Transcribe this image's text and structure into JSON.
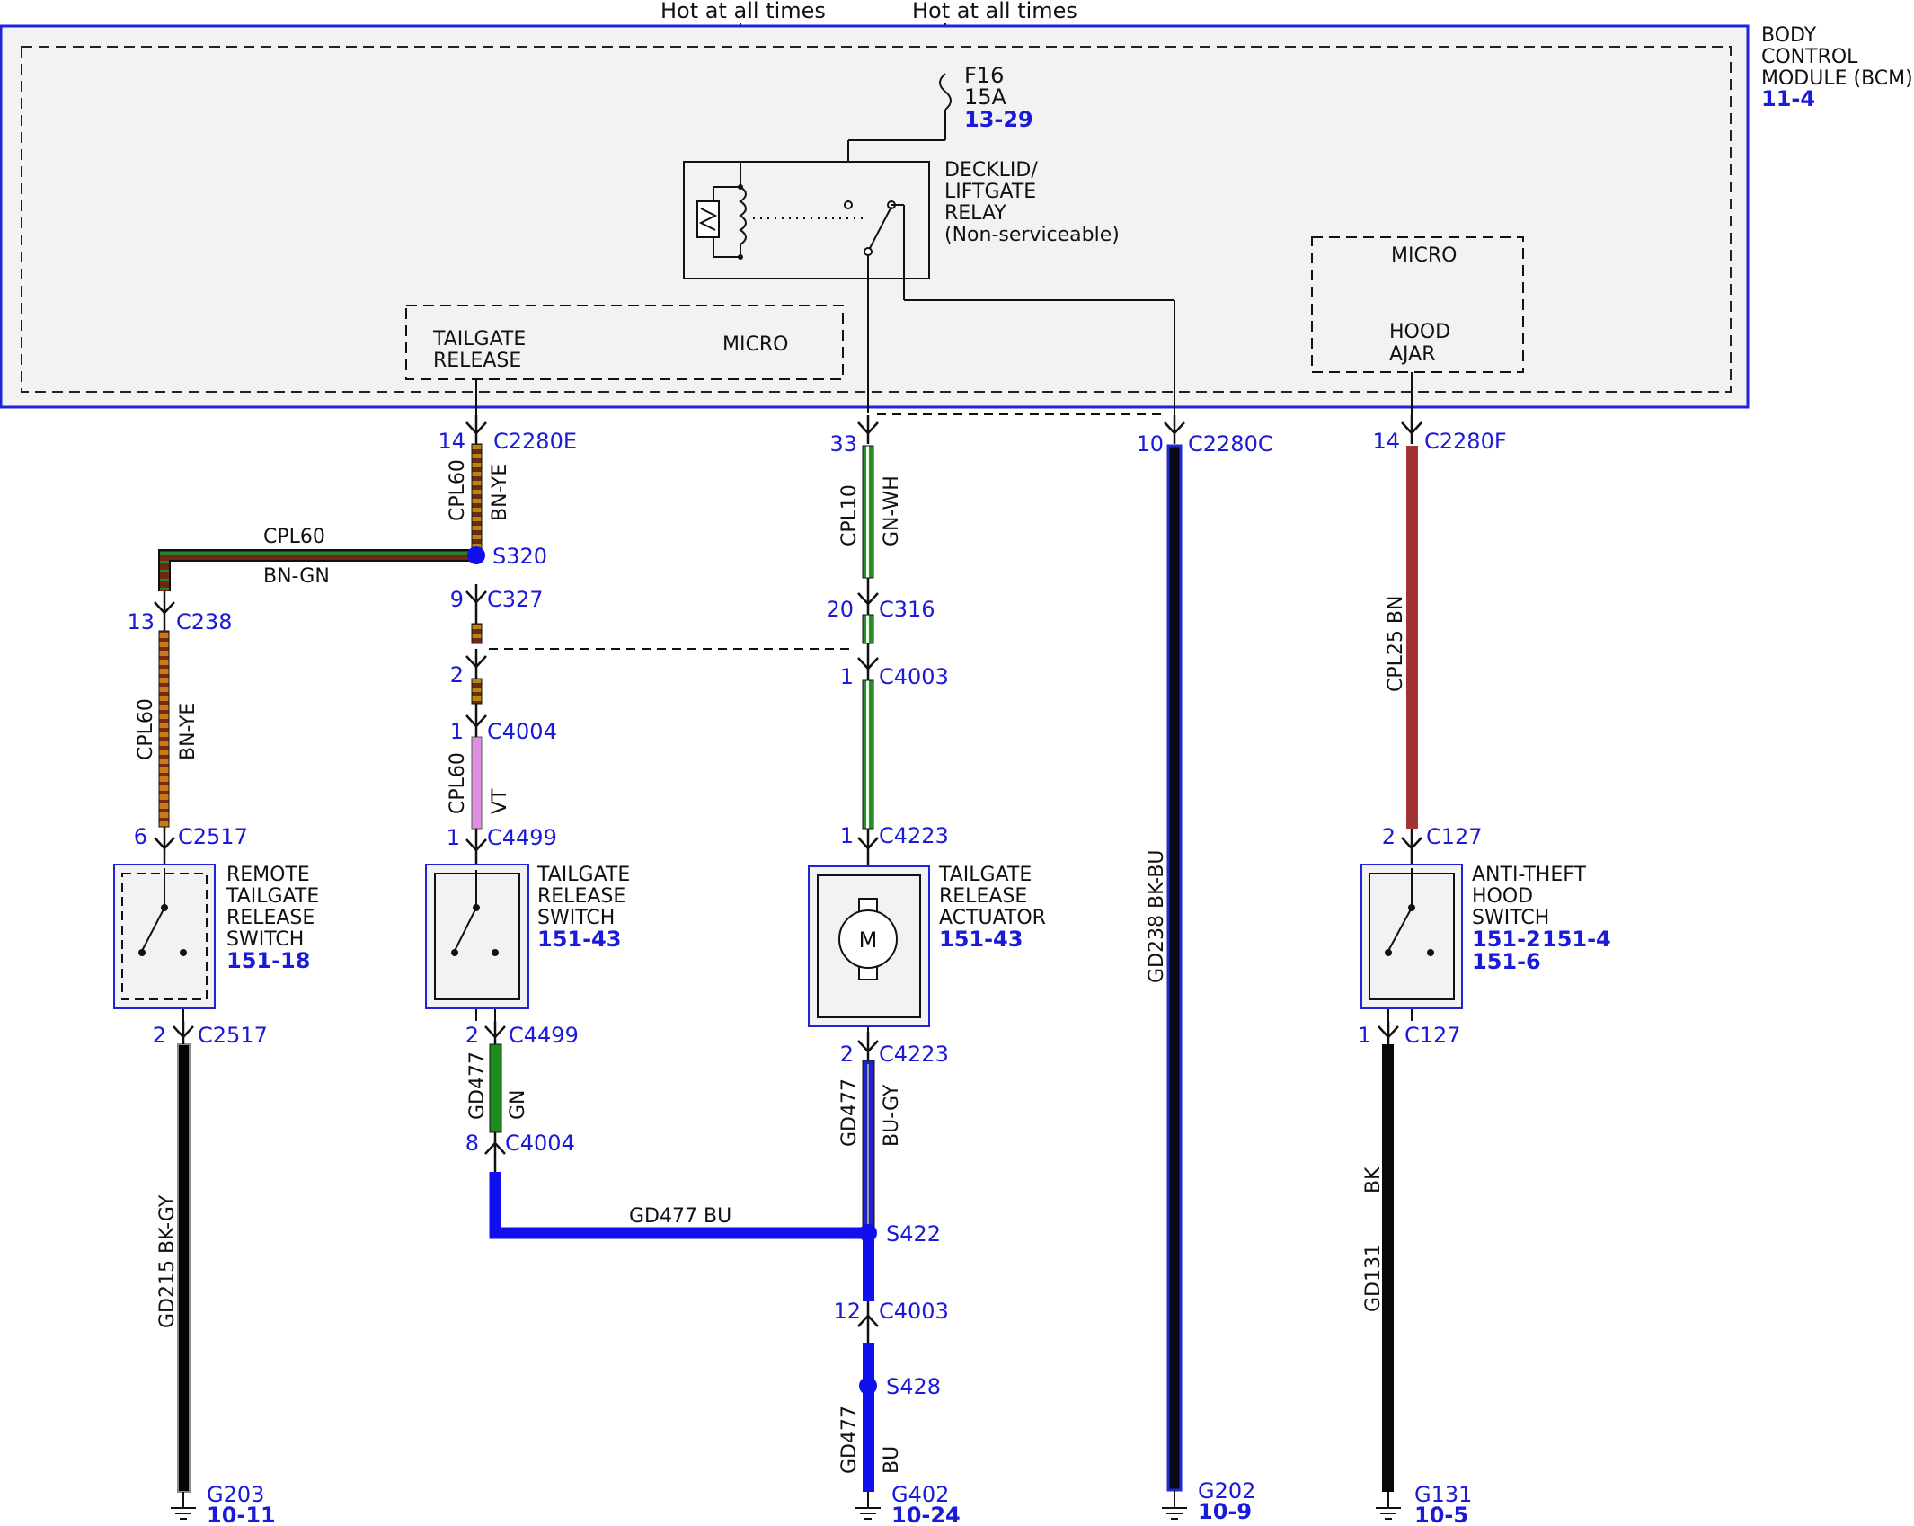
{
  "colors": {
    "module_border": "#2222dd",
    "module_fill": "#f2f2f2",
    "connector_text": "#1a1ad8",
    "BN-YE": [
      "#b8860b",
      "#6b2a14"
    ],
    "BN-GN": [
      "#2e7d32",
      "#6b2a14"
    ],
    "VT": "#e08ee0",
    "GN-WH": [
      "#2e8b2e",
      "#f4fff4"
    ],
    "GN": "#1f8a1f",
    "BU-GY": [
      "#1e22cc",
      "#9a9aa6"
    ],
    "BU": "#1010ee",
    "BK-BU": [
      "#0a0a14",
      "#1f2ad0"
    ],
    "BN": "#a33333",
    "BK-GY": [
      "#050505",
      "#8a8a8a"
    ],
    "BK": "#080808"
  },
  "power": {
    "feed_left": "Hot at all times",
    "feed_right": "Hot at all times"
  },
  "module": {
    "title": [
      "BODY",
      "CONTROL",
      "MODULE (BCM)"
    ],
    "ref": "11-4"
  },
  "fuse": {
    "id": "F16",
    "rating": "15A",
    "ref": "13-29"
  },
  "relay": {
    "name": [
      "DECKLID/",
      "LIFTGATE",
      "RELAY",
      "(Non-serviceable)"
    ]
  },
  "micro_left": {
    "label": "MICRO",
    "signal": [
      "TAILGATE",
      "RELEASE"
    ]
  },
  "micro_right": {
    "label": "MICRO",
    "signal": [
      "HOOD",
      "AJAR"
    ]
  },
  "connectors": {
    "c2280e": {
      "pin": "14",
      "name": "C2280E"
    },
    "c2280e_33": {
      "pin": "33",
      "name": ""
    },
    "c2280c": {
      "pin": "10",
      "name": "C2280C"
    },
    "c2280f": {
      "pin": "14",
      "name": "C2280F"
    },
    "s320": {
      "name": "S320"
    },
    "c327": {
      "pin": "9",
      "name": "C327"
    },
    "c327b": {
      "pin": "2"
    },
    "c4004_1": {
      "pin": "1",
      "name": "C4004"
    },
    "c4499_1": {
      "pin": "1",
      "name": "C4499"
    },
    "c4499_2": {
      "pin": "2",
      "name": "C4499"
    },
    "c4004_8": {
      "pin": "8",
      "name": "C4004"
    },
    "c238": {
      "pin": "13",
      "name": "C238"
    },
    "c2517_6": {
      "pin": "6",
      "name": "C2517"
    },
    "c2517_2": {
      "pin": "2",
      "name": "C2517"
    },
    "c316": {
      "pin": "20",
      "name": "C316"
    },
    "c4003_1": {
      "pin": "1",
      "name": "C4003"
    },
    "c4223_1": {
      "pin": "1",
      "name": "C4223"
    },
    "c4223_2": {
      "pin": "2",
      "name": "C4223"
    },
    "s422": {
      "name": "S422"
    },
    "c4003_12": {
      "pin": "12",
      "name": "C4003"
    },
    "s428": {
      "name": "S428"
    },
    "c127_2": {
      "pin": "2",
      "name": "C127"
    },
    "c127_1": {
      "pin": "1",
      "name": "C127"
    }
  },
  "wires": {
    "cpl60_bnye_top": {
      "circuit": "CPL60",
      "color": "BN-YE"
    },
    "cpl60_bngn": {
      "circuit": "CPL60",
      "color": "BN-GN"
    },
    "cpl60_bnye_left": {
      "circuit": "CPL60",
      "color": "BN-YE"
    },
    "cpl60_vt": {
      "circuit": "CPL60",
      "color": "VT"
    },
    "gd477_gn": {
      "circuit": "GD477",
      "color": "GN"
    },
    "gd477_bu_h": {
      "label": "GD477  BU"
    },
    "cpl10_gnwh": {
      "circuit": "CPL10",
      "color": "GN-WH"
    },
    "gd477_bugy": {
      "circuit": "GD477",
      "color": "BU-GY"
    },
    "gd477_bu_v": {
      "circuit": "GD477",
      "color": "BU"
    },
    "gd238": {
      "label": "GD238  BK-BU"
    },
    "cpl25": {
      "label": "CPL25  BN"
    },
    "gd215": {
      "label": "GD215  BK-GY"
    },
    "gd131": {
      "circuit": "GD131",
      "color": "BK"
    }
  },
  "components": {
    "remote_switch": {
      "name": [
        "REMOTE",
        "TAILGATE",
        "RELEASE",
        "SWITCH"
      ],
      "ref": "151-18"
    },
    "tailgate_switch": {
      "name": [
        "TAILGATE",
        "RELEASE",
        "SWITCH"
      ],
      "ref": "151-43"
    },
    "actuator": {
      "name": [
        "TAILGATE",
        "RELEASE",
        "ACTUATOR"
      ],
      "ref": "151-43",
      "motor": "M"
    },
    "hood_switch": {
      "name": [
        "ANTI-THEFT",
        "HOOD",
        "SWITCH"
      ],
      "ref1": "151-2",
      "ref2": "151-4",
      "ref3": "151-6"
    }
  },
  "grounds": {
    "g203": {
      "name": "G203",
      "ref": "10-11"
    },
    "g402": {
      "name": "G402",
      "ref": "10-24"
    },
    "g202": {
      "name": "G202",
      "ref": "10-9"
    },
    "g131": {
      "name": "G131",
      "ref": "10-5"
    }
  }
}
